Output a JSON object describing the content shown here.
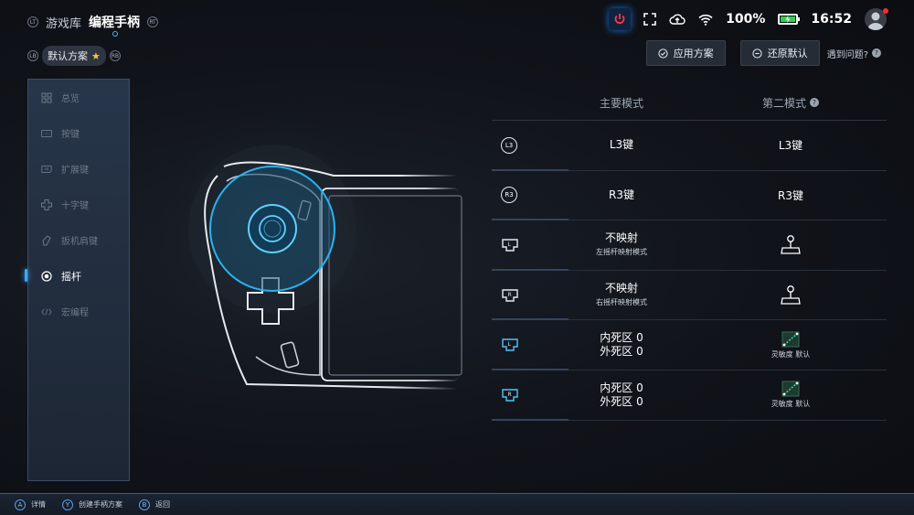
{
  "header": {
    "lt_label": "LT",
    "tab_library": "游戏库",
    "tab_controller": "编程手柄",
    "rt_label": "RT",
    "battery_percent": "100%",
    "time": "16:52"
  },
  "profile": {
    "lb_label": "LB",
    "name": "默认方案",
    "rb_label": "RB"
  },
  "actions": {
    "apply": "应用方案",
    "restore": "还原默认",
    "help": "遇到问题?",
    "help_mark": "?"
  },
  "sidebar": {
    "items": [
      {
        "label": "总览",
        "icon": "overview-icon"
      },
      {
        "label": "按键",
        "icon": "keyboard-icon"
      },
      {
        "label": "扩展键",
        "icon": "extended-key-icon"
      },
      {
        "label": "十字键",
        "icon": "dpad-icon"
      },
      {
        "label": "扳机肩键",
        "icon": "trigger-icon"
      },
      {
        "label": "摇杆",
        "icon": "joystick-icon",
        "active": true
      },
      {
        "label": "宏编程",
        "icon": "code-icon"
      }
    ]
  },
  "table": {
    "header_primary": "主要模式",
    "header_secondary": "第二模式",
    "header_help": "?",
    "rows": [
      {
        "key": "L3",
        "primary": "L3键",
        "secondary": "L3键"
      },
      {
        "key": "R3",
        "primary": "R3键",
        "secondary": "R3键"
      },
      {
        "key": "L",
        "primary": "不映射",
        "primary_sub": "左摇杆映射模式",
        "secondary_icon": "joystick-map-icon"
      },
      {
        "key": "R",
        "primary": "不映射",
        "primary_sub": "右摇杆映射模式",
        "secondary_icon": "joystick-map-icon"
      },
      {
        "key": "L",
        "primary": "内死区 0",
        "primary_line2": "外死区 0",
        "secondary": "灵敏度 默认",
        "secondary_icon": "sensitivity-curve-icon"
      },
      {
        "key": "R",
        "primary": "内死区 0",
        "primary_line2": "外死区 0",
        "secondary": "灵敏度 默认",
        "secondary_icon": "sensitivity-curve-icon"
      }
    ]
  },
  "footer": {
    "a_btn": "A",
    "a_label": "详情",
    "y_btn": "Y",
    "y_label": "创建手柄方案",
    "b_btn": "B",
    "b_label": "返回"
  },
  "colors": {
    "accent": "#3fb6ff",
    "battery": "#2bd44a",
    "power": "#ff3b3b"
  }
}
